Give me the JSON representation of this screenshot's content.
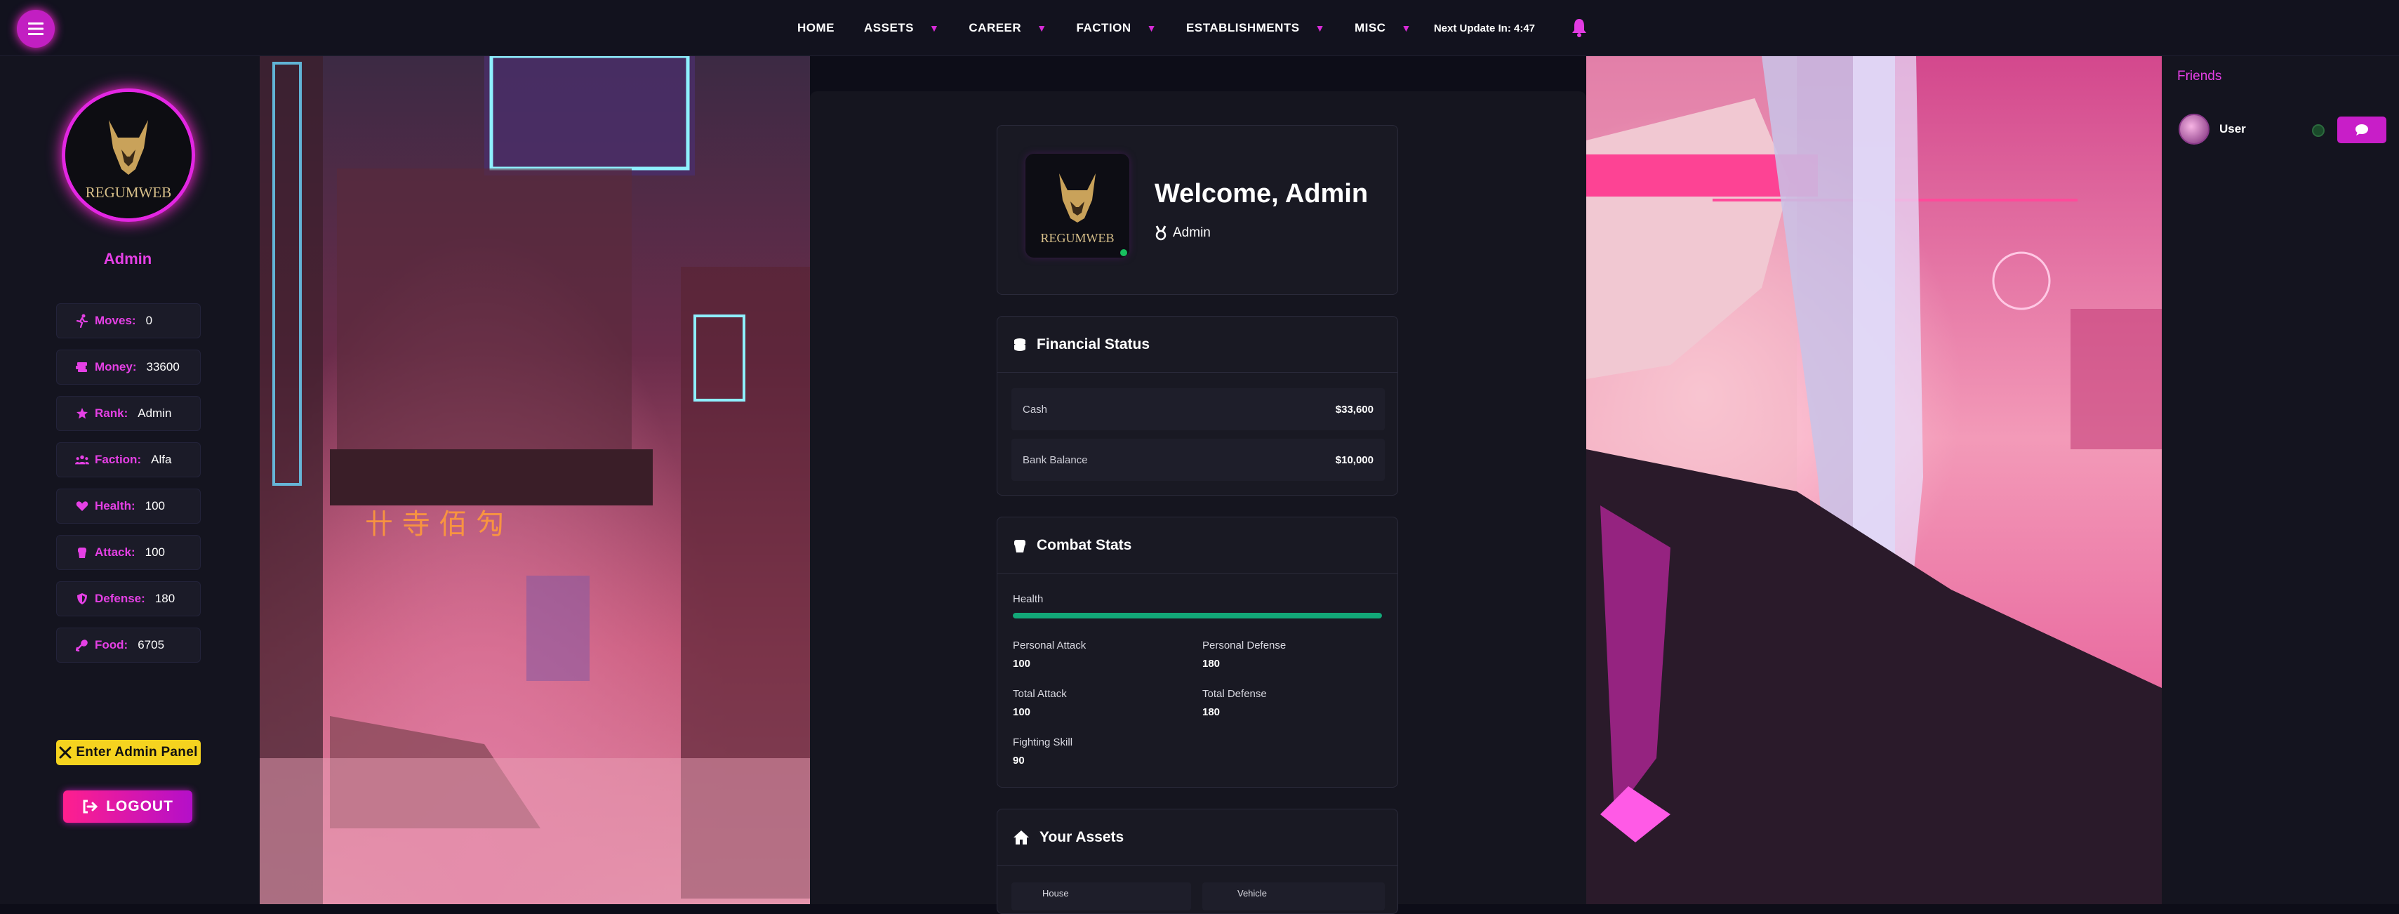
{
  "nav": {
    "items": [
      {
        "label": "HOME",
        "dropdown": false
      },
      {
        "label": "ASSETS",
        "dropdown": true
      },
      {
        "label": "CAREER",
        "dropdown": true
      },
      {
        "label": "FACTION",
        "dropdown": true
      },
      {
        "label": "ESTABLISHMENTS",
        "dropdown": true
      },
      {
        "label": "MISC",
        "dropdown": true
      }
    ],
    "update_text": "Next Update In: 4:47",
    "accent": "#d62bd6"
  },
  "sidebar": {
    "logo_text": "REGUMWEB",
    "username": "Admin",
    "stats": [
      {
        "icon": "running-icon",
        "label": "Moves:",
        "value": "0"
      },
      {
        "icon": "money-icon",
        "label": "Money:",
        "value": "33600"
      },
      {
        "icon": "star-icon",
        "label": "Rank:",
        "value": "Admin"
      },
      {
        "icon": "users-icon",
        "label": "Faction:",
        "value": "Alfa"
      },
      {
        "icon": "heart-icon",
        "label": "Health:",
        "value": "100"
      },
      {
        "icon": "fist-icon",
        "label": "Attack:",
        "value": "100"
      },
      {
        "icon": "shield-icon",
        "label": "Defense:",
        "value": "180"
      },
      {
        "icon": "drumstick-icon",
        "label": "Food:",
        "value": "6705"
      }
    ],
    "admin_button": "Enter Admin Panel",
    "logout_button": "LOGOUT"
  },
  "welcome": {
    "logo_text": "REGUMWEB",
    "title": "Welcome, Admin",
    "role": "Admin"
  },
  "financial": {
    "title": "Financial Status",
    "rows": [
      {
        "label": "Cash",
        "value": "$33,600"
      },
      {
        "label": "Bank Balance",
        "value": "$10,000"
      }
    ]
  },
  "combat": {
    "title": "Combat Stats",
    "health_label": "Health",
    "health_fraction": 1.0,
    "personal_attack_label": "Personal Attack",
    "personal_attack": "100",
    "personal_defense_label": "Personal Defense",
    "personal_defense": "180",
    "total_attack_label": "Total Attack",
    "total_attack": "100",
    "total_defense_label": "Total Defense",
    "total_defense": "180",
    "fighting_skill_label": "Fighting Skill",
    "fighting_skill": "90"
  },
  "assets": {
    "title": "Your Assets",
    "items": [
      "House",
      "Vehicle"
    ]
  },
  "friends": {
    "title": "Friends",
    "list": [
      {
        "name": "User",
        "online": false
      }
    ]
  }
}
